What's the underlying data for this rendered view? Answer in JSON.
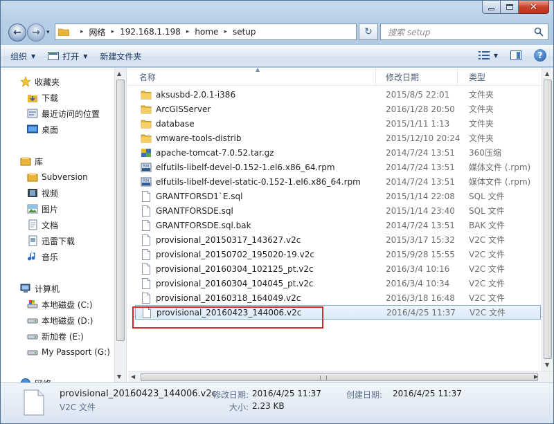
{
  "window": {
    "caption_close": "✕",
    "close_color": "#c7432b"
  },
  "nav": {
    "back_icon": "←",
    "forward_icon": "→",
    "history_arrow": "▾",
    "refresh_icon": "↻",
    "address": {
      "crumbs": [
        "网络",
        "192.168.1.198",
        "home",
        "setup"
      ],
      "separator": "▸"
    },
    "search": {
      "placeholder": "搜索 setup"
    }
  },
  "toolbar": {
    "organize": "组织",
    "open": "打开",
    "new_folder": "新建文件夹",
    "help": "?"
  },
  "sidebar": {
    "favorites_header": "收藏夹",
    "favorites": [
      "下载",
      "最近访问的位置",
      "桌面"
    ],
    "libraries_header": "库",
    "libraries": [
      "Subversion",
      "视频",
      "图片",
      "文档",
      "迅雷下载",
      "音乐"
    ],
    "computer_header": "计算机",
    "drives": [
      "本地磁盘 (C:)",
      "本地磁盘 (D:)",
      "新加卷 (E:)",
      "My Passport (G:)"
    ],
    "network_header": "网络"
  },
  "columns": {
    "name": "名称",
    "date": "修改日期",
    "type": "类型"
  },
  "files": [
    {
      "name": "aksusbd-2.0.1-i386",
      "date": "2015/8/5 22:01",
      "type": "文件夹",
      "icon": "folder"
    },
    {
      "name": "ArcGISServer",
      "date": "2016/1/28 20:50",
      "type": "文件夹",
      "icon": "folder"
    },
    {
      "name": "database",
      "date": "2015/1/11 1:13",
      "type": "文件夹",
      "icon": "folder"
    },
    {
      "name": "vmware-tools-distrib",
      "date": "2015/12/10 20:24",
      "type": "文件夹",
      "icon": "folder"
    },
    {
      "name": "apache-tomcat-7.0.52.tar.gz",
      "date": "2014/7/24 13:51",
      "type": "360压缩",
      "icon": "archive"
    },
    {
      "name": "elfutils-libelf-devel-0.152-1.el6.x86_64.rpm",
      "date": "2014/7/24 13:51",
      "type": "媒体文件 (.rpm)",
      "icon": "media"
    },
    {
      "name": "elfutils-libelf-devel-static-0.152-1.el6.x86_64.rpm",
      "date": "2014/7/24 13:51",
      "type": "媒体文件 (.rpm)",
      "icon": "media"
    },
    {
      "name": "GRANTFORSD1`E.sql",
      "date": "2015/1/14 22:08",
      "type": "SQL 文件",
      "icon": "file"
    },
    {
      "name": "GRANTFORSDE.sql",
      "date": "2015/1/14 23:40",
      "type": "SQL 文件",
      "icon": "file"
    },
    {
      "name": "GRANTFORSDE.sql.bak",
      "date": "2014/7/24 13:51",
      "type": "BAK 文件",
      "icon": "file"
    },
    {
      "name": "provisional_20150317_143627.v2c",
      "date": "2015/3/17 15:32",
      "type": "V2C 文件",
      "icon": "file"
    },
    {
      "name": "provisional_20150702_195020-19.v2c",
      "date": "2015/9/28 15:55",
      "type": "V2C 文件",
      "icon": "file"
    },
    {
      "name": "provisional_20160304_102125_pt.v2c",
      "date": "2016/3/4 10:16",
      "type": "V2C 文件",
      "icon": "file"
    },
    {
      "name": "provisional_20160304_104045_pt.v2c",
      "date": "2016/3/4 10:34",
      "type": "V2C 文件",
      "icon": "file"
    },
    {
      "name": "provisional_20160318_164049.v2c",
      "date": "2016/3/18 16:48",
      "type": "V2C 文件",
      "icon": "file"
    },
    {
      "name": "provisional_20160423_144006.v2c",
      "date": "2016/4/25 11:37",
      "type": "V2C 文件",
      "icon": "file",
      "selected": true
    }
  ],
  "details": {
    "name": "provisional_20160423_144006.v2c",
    "type": "V2C 文件",
    "modified_label": "修改日期:",
    "modified_value": "2016/4/25 11:37",
    "size_label": "大小:",
    "size_value": "2.23 KB",
    "created_label": "创建日期:",
    "created_value": "2016/4/25 11:37"
  },
  "colors": {
    "selection_border": "#84acdd",
    "highlight_box": "#e0262d",
    "folder": "#e8b53a"
  }
}
